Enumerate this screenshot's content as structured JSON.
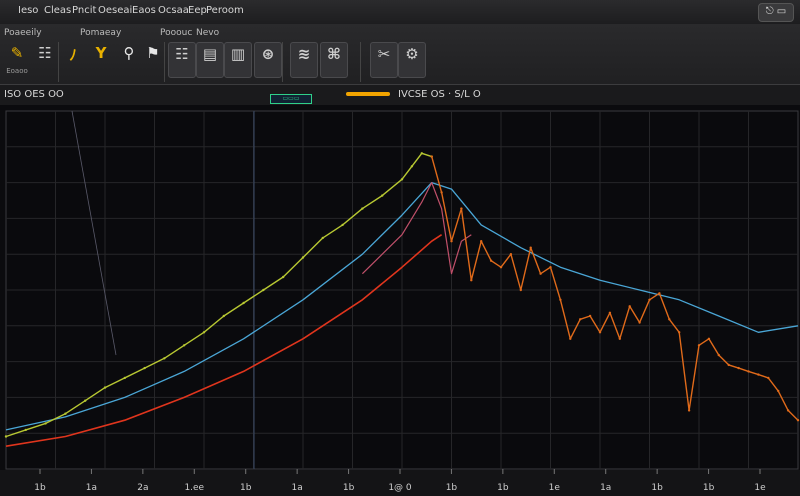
{
  "menu": {
    "items": [
      "Ieso",
      "Cleas",
      "Pncit",
      "Oeseai",
      "Eaos",
      "Ocsaa",
      "Eep",
      "Peroom"
    ],
    "window_button": "⎋ ▭"
  },
  "toolbar": {
    "group_labels": [
      "Poaeeily",
      "Pomaeay",
      "Pooouc",
      "Nevo"
    ],
    "tools": [
      {
        "glyph": "✎",
        "caption": "Eoaoo",
        "color": "#e8b100"
      },
      {
        "glyph": "☷",
        "caption": "",
        "color": "#cfcfcf"
      },
      {
        "glyph": "ﾉ",
        "caption": "",
        "color": "#e8b100"
      },
      {
        "glyph": "Y",
        "caption": "",
        "color": "#e8b100"
      },
      {
        "glyph": "⚲",
        "caption": "",
        "color": "#e6e6e6"
      },
      {
        "glyph": "⚑",
        "caption": "",
        "color": "#e6e6e6"
      },
      {
        "glyph": "☷",
        "caption": "",
        "color": "#cfcfcf"
      },
      {
        "glyph": "▤",
        "caption": "",
        "color": "#cfcfcf"
      },
      {
        "glyph": "▥",
        "caption": "",
        "color": "#cfcfcf"
      },
      {
        "glyph": "⊛",
        "caption": "",
        "color": "#cfcfcf"
      },
      {
        "glyph": "≋",
        "caption": "",
        "color": "#cfcfcf"
      },
      {
        "glyph": "⌘",
        "caption": "",
        "color": "#cfcfcf"
      },
      {
        "glyph": "✂",
        "caption": "",
        "color": "#cfcfcf"
      },
      {
        "glyph": "⚙",
        "caption": "",
        "color": "#cfcfcf"
      }
    ]
  },
  "status": {
    "left_text": "ISO  OES  OO",
    "zoom_label": "▭▭▭",
    "progress": 1.0,
    "quote_text": "IVCSE  OS  ·  S/L  O"
  },
  "colors": {
    "accent": "#e8b100",
    "green_price": "#b8c832",
    "orange_price": "#e06a1a",
    "red_ma": "#e0351d",
    "blue_ma": "#4aa6d6",
    "pink_ma": "#c0506a",
    "grid": "#262629"
  },
  "chart_data": {
    "type": "line",
    "x_tick_labels": [
      "1b",
      "1a",
      "2a",
      "1.ee",
      "1b",
      "1a",
      "1b",
      "1@ 0",
      "1b",
      "1b",
      "1e",
      "1a",
      "1b",
      "1b",
      "1e"
    ],
    "series": [
      {
        "key": "price_up",
        "x": [
          0,
          20,
          40,
          60,
          80,
          100,
          120,
          140,
          160,
          180,
          200,
          220,
          240,
          260,
          280,
          300,
          320,
          340,
          360,
          380,
          400,
          410,
          420,
          430
        ],
        "y": [
          10,
          12,
          14,
          17,
          21,
          25,
          28,
          31,
          34,
          38,
          42,
          47,
          51,
          55,
          59,
          65,
          71,
          75,
          80,
          84,
          89,
          93,
          97,
          96
        ]
      },
      {
        "key": "price_down",
        "x": [
          430,
          440,
          450,
          460,
          470,
          480,
          490,
          500,
          510,
          520,
          530,
          540,
          550,
          560,
          570,
          580,
          590,
          600,
          610,
          620,
          630,
          640,
          650,
          660,
          670,
          680,
          690,
          700,
          710,
          720,
          730,
          740,
          750,
          760,
          770,
          780,
          790,
          800
        ],
        "y": [
          96,
          85,
          70,
          80,
          58,
          70,
          64,
          62,
          66,
          55,
          68,
          60,
          62,
          52,
          40,
          46,
          47,
          42,
          48,
          40,
          50,
          45,
          52,
          54,
          46,
          42,
          18,
          38,
          40,
          35,
          32,
          31,
          30,
          29,
          28,
          24,
          18,
          15
        ]
      },
      {
        "key": "ma_blue",
        "x": [
          0,
          60,
          120,
          180,
          240,
          300,
          360,
          400,
          430,
          450,
          480,
          520,
          560,
          600,
          640,
          680,
          720,
          760,
          800
        ],
        "y": [
          12,
          16,
          22,
          30,
          40,
          52,
          66,
          78,
          88,
          86,
          75,
          68,
          62,
          58,
          55,
          52,
          47,
          42,
          44
        ]
      },
      {
        "key": "ma_red",
        "x": [
          0,
          60,
          120,
          180,
          240,
          300,
          360,
          400,
          430,
          440
        ],
        "y": [
          7,
          10,
          15,
          22,
          30,
          40,
          52,
          62,
          70,
          72
        ]
      },
      {
        "key": "ma_pink",
        "x": [
          360,
          380,
          400,
          420,
          430,
          440,
          450,
          460,
          470
        ],
        "y": [
          60,
          66,
          72,
          82,
          88,
          80,
          60,
          70,
          72
        ]
      }
    ],
    "ylim": [
      0,
      110
    ],
    "xlim": [
      0,
      800
    ],
    "grid": true
  }
}
